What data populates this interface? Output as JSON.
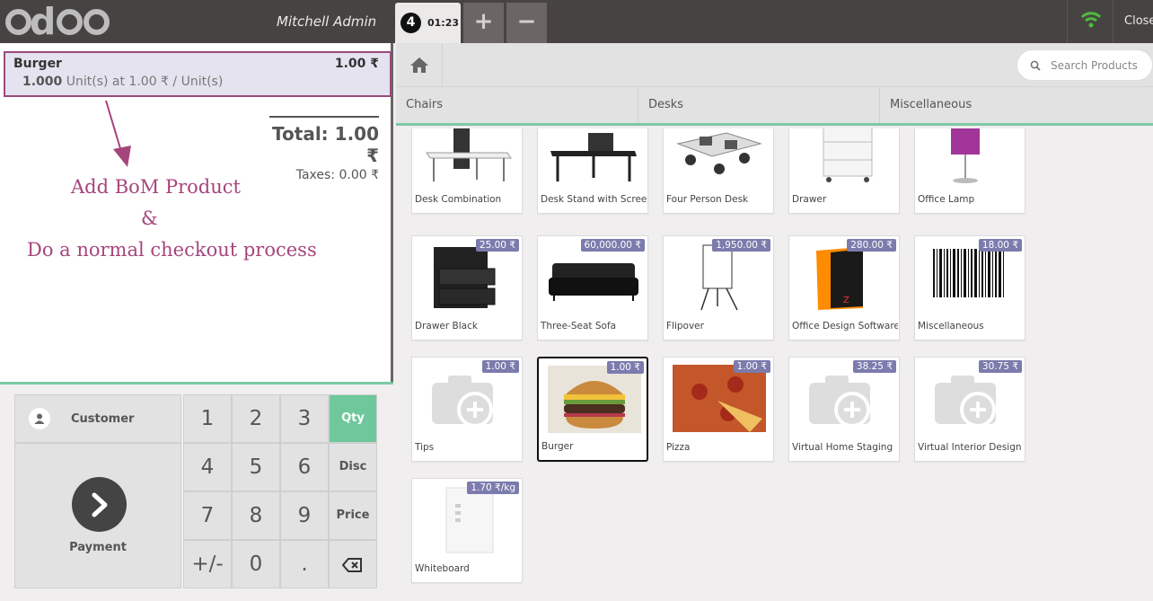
{
  "header": {
    "logo_text": "odoo",
    "user": "Mitchell Admin",
    "order_number": "4",
    "order_time": "01:23",
    "add_order_symbol": "+",
    "remove_order_symbol": "−",
    "close_label": "Close",
    "wifi_color": "#4dbb3a"
  },
  "order": {
    "line": {
      "name": "Burger",
      "price": "1.00 ₹",
      "qty": "1.000",
      "detail": " Unit(s) at 1.00 ₹ / Unit(s)"
    },
    "total": "Total: 1.00 ₹",
    "taxes": "Taxes: 0.00 ₹"
  },
  "annotation": {
    "line1": "Add BoM Product",
    "line2": "&",
    "line3": "Do a normal checkout process",
    "color": "#a6457d"
  },
  "controls": {
    "customer": "Customer",
    "payment": "Payment",
    "keys": [
      "1",
      "2",
      "3",
      "4",
      "5",
      "6",
      "7",
      "8",
      "9",
      "+/-",
      "0",
      "."
    ],
    "modes": [
      "Qty",
      "Disc",
      "Price"
    ],
    "active_mode": "Qty",
    "accent": "#6ec89b"
  },
  "search": {
    "placeholder": "Search Products"
  },
  "categories": [
    "Chairs",
    "Desks",
    "Miscellaneous"
  ],
  "products": [
    {
      "name": "Desk Combination",
      "price": "",
      "icon": "desk-icon"
    },
    {
      "name": "Desk Stand with Screen",
      "price": "",
      "icon": "desk-icon"
    },
    {
      "name": "Four Person Desk",
      "price": "",
      "icon": "office-icon"
    },
    {
      "name": "Drawer",
      "price": "",
      "icon": "drawer-icon"
    },
    {
      "name": "Office Lamp",
      "price": "",
      "icon": "lamp-icon"
    },
    {
      "name": "Drawer Black",
      "price": "25.00 ₹",
      "icon": "drawer-icon"
    },
    {
      "name": "Three-Seat Sofa",
      "price": "60,000.00 ₹",
      "icon": "sofa-icon"
    },
    {
      "name": "Flipover",
      "price": "1,950.00 ₹",
      "icon": "flipchart-icon"
    },
    {
      "name": "Office Design Software",
      "price": "280.00 ₹",
      "icon": "software-box-icon"
    },
    {
      "name": "Miscellaneous",
      "price": "18.00 ₹",
      "icon": "barcode-icon"
    },
    {
      "name": "Tips",
      "price": "1.00 ₹",
      "icon": "camera-placeholder-icon"
    },
    {
      "name": "Burger",
      "price": "1.00 ₹",
      "icon": "burger-icon"
    },
    {
      "name": "Pizza",
      "price": "1.00 ₹",
      "icon": "pizza-icon"
    },
    {
      "name": "Virtual Home Staging",
      "price": "38.25 ₹",
      "icon": "camera-placeholder-icon"
    },
    {
      "name": "Virtual Interior Design",
      "price": "30.75 ₹",
      "icon": "camera-placeholder-icon"
    },
    {
      "name": "Whiteboard",
      "price": "1.70 ₹/kg",
      "icon": "whiteboard-icon"
    }
  ],
  "price_badge_color": "#7c7bad"
}
